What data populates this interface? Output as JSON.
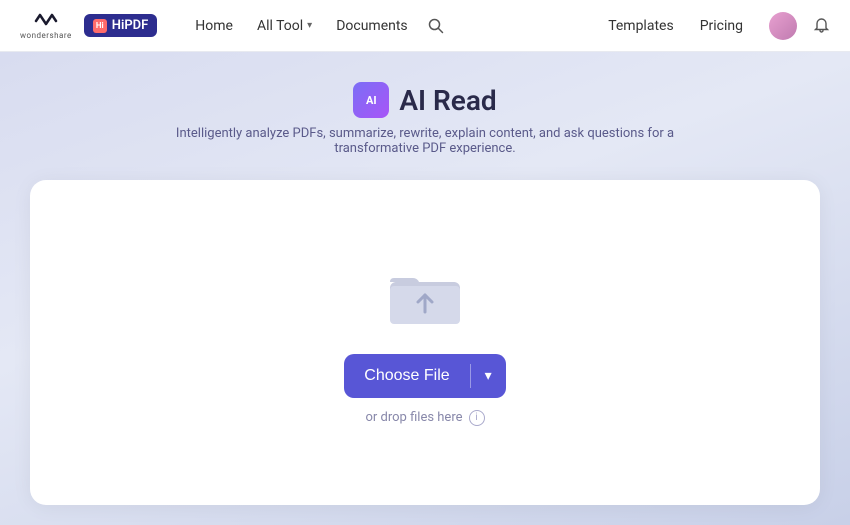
{
  "navbar": {
    "wondershare_label": "wondershare",
    "hipdf_label": "HiPDF",
    "hipdf_icon_text": "Hi",
    "nav_home": "Home",
    "nav_all_tool": "All Tool",
    "nav_documents": "Documents",
    "nav_templates": "Templates",
    "nav_pricing": "Pricing",
    "search_icon": "search-icon",
    "bell_icon": "bell-icon",
    "avatar_icon": "avatar-icon"
  },
  "page": {
    "ai_badge": "AI",
    "title": "AI Read",
    "subtitle": "Intelligently analyze PDFs, summarize, rewrite, explain content, and ask questions for a transformative PDF experience."
  },
  "upload": {
    "choose_file_label": "Choose File",
    "drop_hint": "or drop files here",
    "info_icon": "ⓘ"
  }
}
